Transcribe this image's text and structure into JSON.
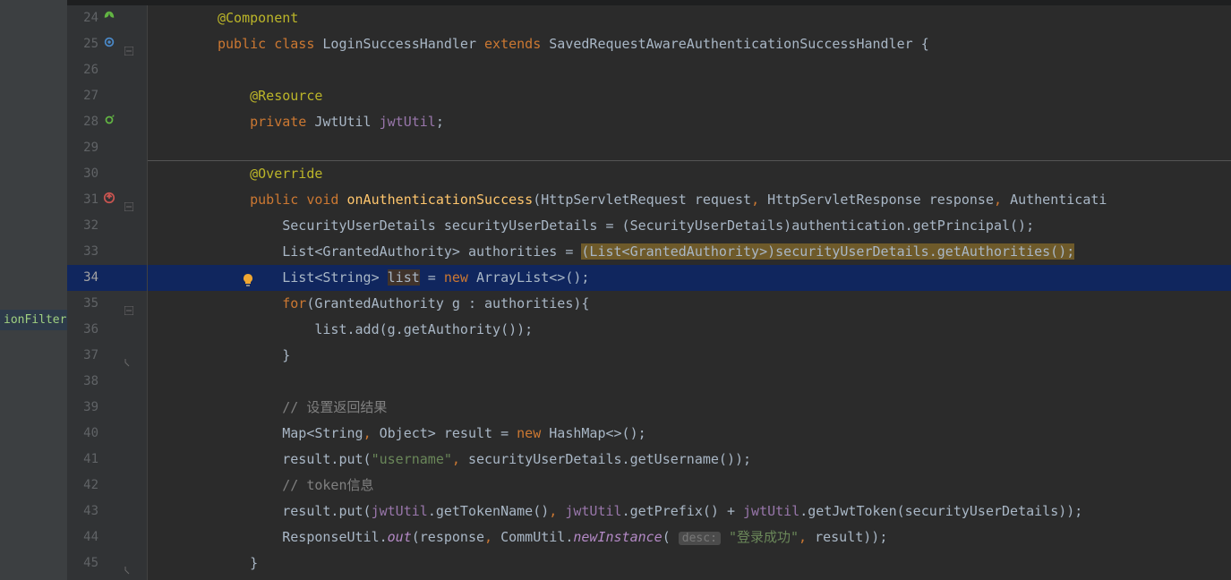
{
  "sidebar": {
    "visible_item": "ionFilter"
  },
  "lines": [
    {
      "n": 24,
      "indent": 0,
      "tokens": [
        [
          "annotation",
          "@Component"
        ]
      ],
      "icons": [
        "leaf"
      ]
    },
    {
      "n": 25,
      "indent": 0,
      "tokens": [
        [
          "keyword",
          "public "
        ],
        [
          "keyword",
          "class "
        ],
        [
          "class",
          "LoginSuccessHandler "
        ],
        [
          "keyword",
          "extends "
        ],
        [
          "class",
          "SavedRequestAwareAuthenticationSuccessHandler {"
        ]
      ],
      "icons": [
        "gear"
      ],
      "fold": "minus"
    },
    {
      "n": 26,
      "indent": 0,
      "tokens": []
    },
    {
      "n": 27,
      "indent": 1,
      "tokens": [
        [
          "annotation",
          "@Resource"
        ]
      ]
    },
    {
      "n": 28,
      "indent": 1,
      "tokens": [
        [
          "keyword",
          "private "
        ],
        [
          "class",
          "JwtUtil "
        ],
        [
          "field",
          "jwtUtil"
        ],
        [
          "plain",
          ";"
        ]
      ],
      "icons": [
        "recycle"
      ]
    },
    {
      "n": 29,
      "indent": 0,
      "tokens": []
    },
    {
      "n": 30,
      "indent": 1,
      "tokens": [
        [
          "annotation",
          "@Override"
        ]
      ]
    },
    {
      "n": 31,
      "indent": 1,
      "tokens": [
        [
          "keyword",
          "public "
        ],
        [
          "keyword",
          "void "
        ],
        [
          "method",
          "onAuthenticationSuccess"
        ],
        [
          "plain",
          "(HttpServletRequest request"
        ],
        [
          "keyword",
          ", "
        ],
        [
          "plain",
          "HttpServletResponse response"
        ],
        [
          "keyword",
          ", "
        ],
        [
          "plain",
          "Authenticati"
        ]
      ],
      "icons": [
        "override"
      ],
      "fold": "minus"
    },
    {
      "n": 32,
      "indent": 2,
      "tokens": [
        [
          "class",
          "SecurityUserDetails securityUserDetails = (SecurityUserDetails)authentication.getPrincipal();"
        ]
      ]
    },
    {
      "n": 33,
      "indent": 2,
      "tokens": [
        [
          "class",
          "List<GrantedAuthority> authorities = "
        ],
        [
          "cast",
          "(List<GrantedAuthority>)securityUserDetails.getAuthorities();"
        ]
      ]
    },
    {
      "n": 34,
      "indent": 2,
      "selected": true,
      "bulb": true,
      "tokens": [
        [
          "class",
          "List<String> "
        ],
        [
          "hlvar",
          "list"
        ],
        [
          "plain",
          " = "
        ],
        [
          "keyword",
          "new "
        ],
        [
          "class",
          "ArrayList"
        ],
        [
          "plain",
          "<>();"
        ]
      ]
    },
    {
      "n": 35,
      "indent": 2,
      "tokens": [
        [
          "keyword",
          "for"
        ],
        [
          "plain",
          "(GrantedAuthority g : authorities){"
        ]
      ],
      "fold": "minus"
    },
    {
      "n": 36,
      "indent": 3,
      "tokens": [
        [
          "plain",
          "list.add(g.getAuthority());"
        ]
      ]
    },
    {
      "n": 37,
      "indent": 2,
      "tokens": [
        [
          "plain",
          "}"
        ]
      ],
      "fold": "close"
    },
    {
      "n": 38,
      "indent": 0,
      "tokens": []
    },
    {
      "n": 39,
      "indent": 2,
      "tokens": [
        [
          "comment",
          "// 设置返回结果"
        ]
      ]
    },
    {
      "n": 40,
      "indent": 2,
      "tokens": [
        [
          "class",
          "Map<String"
        ],
        [
          "keyword",
          ", "
        ],
        [
          "class",
          "Object> result = "
        ],
        [
          "keyword",
          "new "
        ],
        [
          "class",
          "HashMap"
        ],
        [
          "plain",
          "<>();"
        ]
      ]
    },
    {
      "n": 41,
      "indent": 2,
      "tokens": [
        [
          "plain",
          "result.put("
        ],
        [
          "string",
          "\"username\""
        ],
        [
          "keyword",
          ", "
        ],
        [
          "plain",
          "securityUserDetails.getUsername());"
        ]
      ]
    },
    {
      "n": 42,
      "indent": 2,
      "tokens": [
        [
          "comment",
          "// token信息"
        ]
      ]
    },
    {
      "n": 43,
      "indent": 2,
      "tokens": [
        [
          "plain",
          "result.put("
        ],
        [
          "field",
          "jwtUtil"
        ],
        [
          "plain",
          ".getTokenName()"
        ],
        [
          "keyword",
          ", "
        ],
        [
          "field",
          "jwtUtil"
        ],
        [
          "plain",
          ".getPrefix() + "
        ],
        [
          "field",
          "jwtUtil"
        ],
        [
          "plain",
          ".getJwtToken(securityUserDetails));"
        ]
      ]
    },
    {
      "n": 44,
      "indent": 2,
      "tokens": [
        [
          "class",
          "ResponseUtil."
        ],
        [
          "static",
          "out"
        ],
        [
          "plain",
          "(response"
        ],
        [
          "keyword",
          ", "
        ],
        [
          "class",
          "CommUtil."
        ],
        [
          "static",
          "newInstance"
        ],
        [
          "plain",
          "( "
        ],
        [
          "inlay",
          "desc:"
        ],
        [
          "plain",
          " "
        ],
        [
          "string",
          "\"登录成功\""
        ],
        [
          "keyword",
          ", "
        ],
        [
          "plain",
          "result));"
        ]
      ]
    },
    {
      "n": 45,
      "indent": 1,
      "tokens": [
        [
          "plain",
          "}"
        ]
      ],
      "fold": "close"
    }
  ]
}
